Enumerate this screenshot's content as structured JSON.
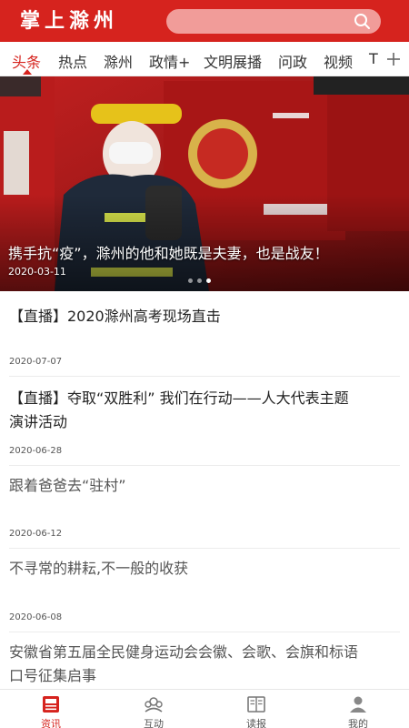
{
  "header": {
    "logo_text": "掌上滁州",
    "search_icon": "search-icon"
  },
  "tabs": [
    {
      "label": "头条",
      "active": true
    },
    {
      "label": "热点"
    },
    {
      "label": "滁州"
    },
    {
      "label": "政情+"
    },
    {
      "label": "文明展播"
    },
    {
      "label": "问政"
    },
    {
      "label": "视频"
    },
    {
      "label": "T"
    }
  ],
  "tabs_more_icon": "plus-icon",
  "banner": {
    "caption": "携手抗“疫”，滁州的他和她既是夫妻，也是战友！",
    "date": "2020-03-11",
    "slide_count": 3,
    "active_slide": 2
  },
  "news": [
    {
      "title": "【直播】2020滁州高考现场直击",
      "date": "2020-07-07"
    },
    {
      "title_line1": "【直播】夺取“双胜利” 我们在行动——人大代表主题",
      "title_line2": "演讲活动",
      "date": "2020-06-28"
    },
    {
      "title": "跟着爸爸去“驻村”",
      "date": "2020-06-12"
    },
    {
      "title": "不寻常的耕耘,不一般的收获",
      "date": "2020-06-08"
    },
    {
      "title_line1": "安徽省第五届全民健身运动会会徽、会歌、会旗和标语",
      "title_line2": "口号征集启事"
    }
  ],
  "bottom_nav": [
    {
      "label": "资讯",
      "icon": "news-icon",
      "active": true
    },
    {
      "label": "互动",
      "icon": "community-icon"
    },
    {
      "label": "读报",
      "icon": "newspaper-book-icon"
    },
    {
      "label": "我的",
      "icon": "user-icon"
    }
  ],
  "colors": {
    "brand_red": "#d6231e",
    "search_bg": "#f19c99"
  }
}
